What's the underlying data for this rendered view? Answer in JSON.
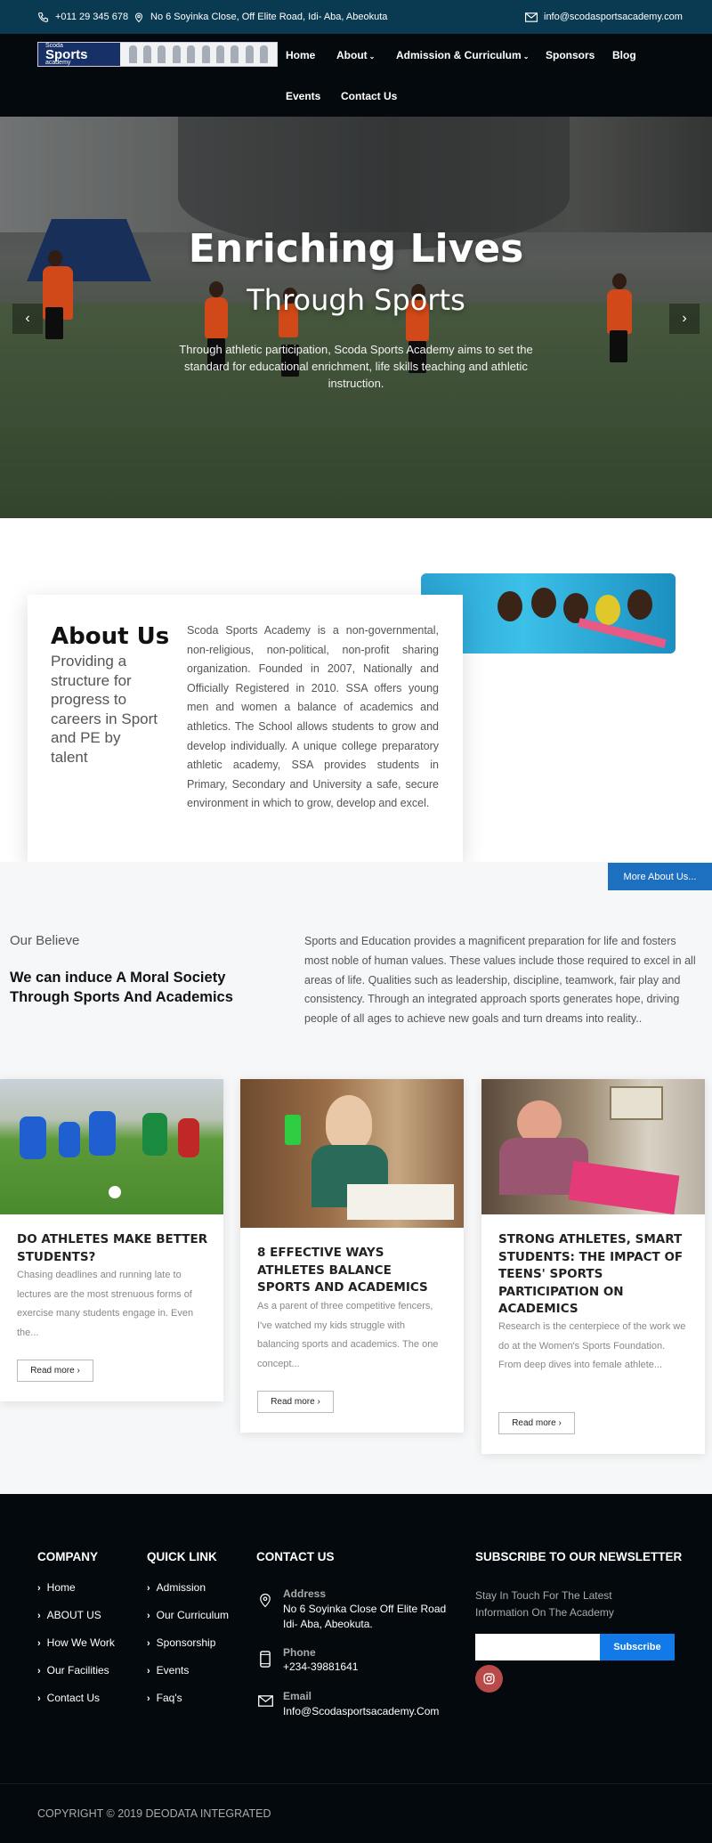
{
  "topbar": {
    "phone": "+011 29 345 678",
    "address": "No 6 Soyinka Close, Off Elite Road, Idi- Aba, Abeokuta",
    "email": "info@scodasportsacademy.com"
  },
  "logo": {
    "line1": "Scoda",
    "line2": "Sports",
    "line3": "academy"
  },
  "nav": {
    "home": "Home",
    "about": "About",
    "admission": "Admission & Curriculum",
    "sponsors": "Sponsors",
    "blog": "Blog",
    "events": "Events",
    "contact": "Contact Us",
    "caret": "⌄"
  },
  "hero": {
    "title": "Enriching Lives",
    "subtitle": "Through Sports",
    "description": "Through athletic participation, Scoda Sports Academy aims to set the standard for educational enrichment, life skills teaching and athletic instruction.",
    "prev": "‹",
    "next": "›"
  },
  "about": {
    "title": "About Us",
    "tagline": "Providing a structure for progress to careers in Sport and PE by talent",
    "text": "Scoda Sports Academy is a non-governmental, non-religious, non-political, non-profit sharing organization. Founded in 2007, Nationally and Officially Registered in 2010. SSA offers young men and women a balance of academics and athletics. The School allows students to grow and develop individually. A unique college preparatory athletic academy, SSA provides students in Primary, Secondary and University a safe, secure environment in which to grow, develop and excel.",
    "more_button": "More About Us..."
  },
  "believe": {
    "label": "Our Believe",
    "heading": "We can induce A Moral Society Through Sports And Academics",
    "text": "Sports and Education provides a magnificent preparation for life and fosters most noble of human values. These values include those required to excel in all areas of life. Qualities such as leadership, discipline, teamwork, fair play and consistency. Through an integrated approach sports generates hope, driving people of all ages to achieve new goals and turn dreams into reality.."
  },
  "posts": [
    {
      "title": "DO ATHLETES MAKE BETTER STUDENTS?",
      "excerpt": "Chasing deadlines and running late to lectures are the most strenuous forms of exercise many students engage in. Even the...",
      "read_more": "Read more"
    },
    {
      "title": "8 EFFECTIVE WAYS ATHLETES BALANCE SPORTS AND ACADEMICS",
      "excerpt": "As a parent of three competitive fencers, I've watched my kids struggle with balancing sports and academics. The one concept...",
      "read_more": "Read more"
    },
    {
      "title": "STRONG ATHLETES, SMART STUDENTS: THE IMPACT OF TEENS' SPORTS PARTICIPATION ON ACADEMICS",
      "excerpt": "Research is the centerpiece of the work we do at the Women's Sports Foundation. From deep dives into female athlete...",
      "read_more": "Read more"
    }
  ],
  "footer": {
    "company_heading": "COMPANY",
    "company_links": [
      "Home",
      "ABOUT US",
      "How We Work",
      "Our Facilities",
      "Contact Us"
    ],
    "quick_heading": "QUICK LINK",
    "quick_links": [
      "Admission",
      "Our Curriculum",
      "Sponsorship",
      "Events",
      "Faq's"
    ],
    "contact_heading": "CONTACT US",
    "address_label": "Address",
    "address_line1": "No 6 Soyinka Close Off Elite Road",
    "address_line2": "Idi- Aba, Abeokuta.",
    "phone_label": "Phone",
    "phone_value": "+234-39881641",
    "email_label": "Email",
    "email_value": "Info@Scodasportsacademy.Com",
    "newsletter_heading": "SUBSCRIBE TO OUR NEWSLETTER",
    "newsletter_text": "Stay In Touch For The Latest Information On The Academy",
    "subscribe_button": "Subscribe",
    "copyright": "COPYRIGHT © 2019 DEODATA INTEGRATED"
  },
  "colors": {
    "topbar": "#0a3a52",
    "nav": "#03090d",
    "accent": "#1d6fbf",
    "subscribe": "#1279e8"
  }
}
